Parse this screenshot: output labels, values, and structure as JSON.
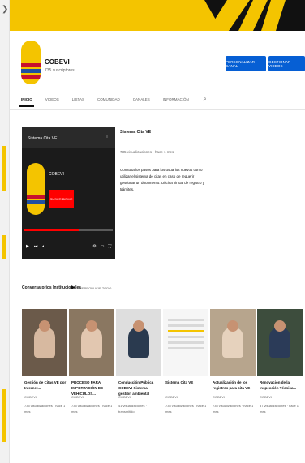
{
  "colors": {
    "accent_blue": "#065fd4",
    "brand_yellow": "#f4c400",
    "subscribe_red": "#ff0000"
  },
  "channel": {
    "name": "COBEVI",
    "subscribers": "735 suscriptores",
    "customize_label": "PERSONALIZAR CANAL",
    "manage_label": "GESTIONAR VIDEOS"
  },
  "tabs": [
    {
      "label": "INICIO",
      "active": true
    },
    {
      "label": "VIDEOS",
      "active": false
    },
    {
      "label": "LISTAS",
      "active": false
    },
    {
      "label": "COMUNIDAD",
      "active": false
    },
    {
      "label": "CANALES",
      "active": false
    },
    {
      "label": "INFORMACIÓN",
      "active": false
    }
  ],
  "tab_search_icon": "search-icon",
  "featured": {
    "player_title": "Sistema Cita VE",
    "player_brand": "COBEVI",
    "player_subscribe": "SUSCRIBIRME",
    "progress": 0.62,
    "title": "Sistema Cita VE",
    "meta": "735 visualizaciones · hace 1 mes",
    "description": "Consulta los pasos para los usuarios nuevos como utilizar el sistema de citas en caso de requerir gestionar un documento. Oficina virtual de registro y trámites."
  },
  "section": {
    "title": "Conversatorios Institucionales",
    "play_all": "REPRODUCIR TODO"
  },
  "cards": [
    {
      "title": "Gestión de Citas VE por Internet...",
      "channel": "COBEVI",
      "views": "735 visualizaciones · hace 1 mes",
      "thumb": "person",
      "bg": "#6b5a4a",
      "shirt": "#d7b9a0"
    },
    {
      "title": "PROCESO PARA IMPORTACIÓN DE VEHÍCULOS...",
      "channel": "COBEVI",
      "views": "735 visualizaciones · hace 1 mes",
      "thumb": "person",
      "bg": "#8a7761",
      "shirt": "#e2c7b0"
    },
    {
      "title": "Conducción Pública COBEVI Sistema gestión ambiental",
      "channel": "COBEVI",
      "views": "41 visualizaciones · transmitido",
      "thumb": "person",
      "bg": "#dedede",
      "shirt": "#2a3a4f"
    },
    {
      "title": "Sistema Cita VE",
      "channel": "COBEVI",
      "views": "735 visualizaciones · hace 1 mes",
      "thumb": "page",
      "bg": "#f6f6f6",
      "shirt": "#1b1b1b"
    },
    {
      "title": "Actualización de los registros para cita VE",
      "channel": "COBEVI",
      "views": "735 visualizaciones · hace 1 mes",
      "thumb": "person",
      "bg": "#b7a58d",
      "shirt": "#e6d2bd"
    },
    {
      "title": "Renovación de la Inspección Técnica...",
      "channel": "COBEVI",
      "views": "37 visualizaciones · hace 1 mes",
      "thumb": "person",
      "bg": "#3d4d3d",
      "shirt": "#2b3b58"
    }
  ]
}
